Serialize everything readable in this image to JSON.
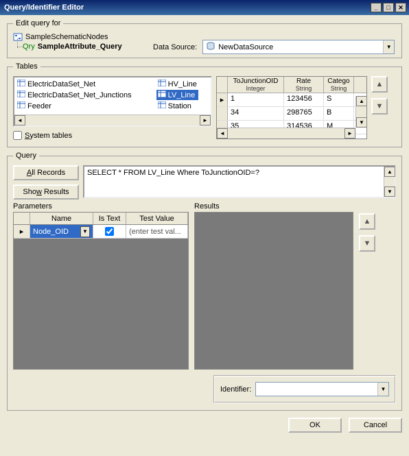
{
  "window": {
    "title": "Query/Identifier Editor"
  },
  "editQuery": {
    "legend": "Edit query for",
    "treeRoot": "SampleSchematicNodes",
    "qryPrefix": "Qry",
    "qryName": "SampleAttribute_Query",
    "dataSourceLabel": "Data Source:",
    "dataSourceValue": "NewDataSource"
  },
  "tables": {
    "legend": "Tables",
    "col1": [
      "ElectricDataSet_Net",
      "ElectricDataSet_Net_Junctions",
      "Feeder"
    ],
    "col2": [
      "HV_Line",
      "LV_Line",
      "Station"
    ],
    "selected": "LV_Line",
    "systemTablesLabel": "System tables",
    "systemTablesAccel": "S",
    "grid": {
      "headers": [
        {
          "title": "ToJunctionOID",
          "sub": "Integer"
        },
        {
          "title": "Rate",
          "sub": "String"
        },
        {
          "title": "Catego",
          "sub": "String"
        }
      ],
      "rows": [
        {
          "c1": "1",
          "c2": "123456",
          "c3": "S"
        },
        {
          "c1": "34",
          "c2": "298765",
          "c3": "B"
        },
        {
          "c1": "35",
          "c2": "314536",
          "c3": "M"
        }
      ]
    }
  },
  "query": {
    "legend": "Query",
    "allRecords": "All Records",
    "allRecordsAccel": "A",
    "showResults": "Show Results",
    "showResultsAccel": "w",
    "sql": "SELECT * FROM LV_Line Where ToJunctionOID=?",
    "paramsLabel": "Parameters",
    "resultsLabel": "Results",
    "paramsHeaders": {
      "name": "Name",
      "isText": "Is Text",
      "testValue": "Test Value"
    },
    "paramRow": {
      "name": "Node_OID",
      "isText": true,
      "testValue": "(enter test val..."
    }
  },
  "identifier": {
    "label": "Identifier:",
    "value": ""
  },
  "footer": {
    "ok": "OK",
    "cancel": "Cancel"
  }
}
